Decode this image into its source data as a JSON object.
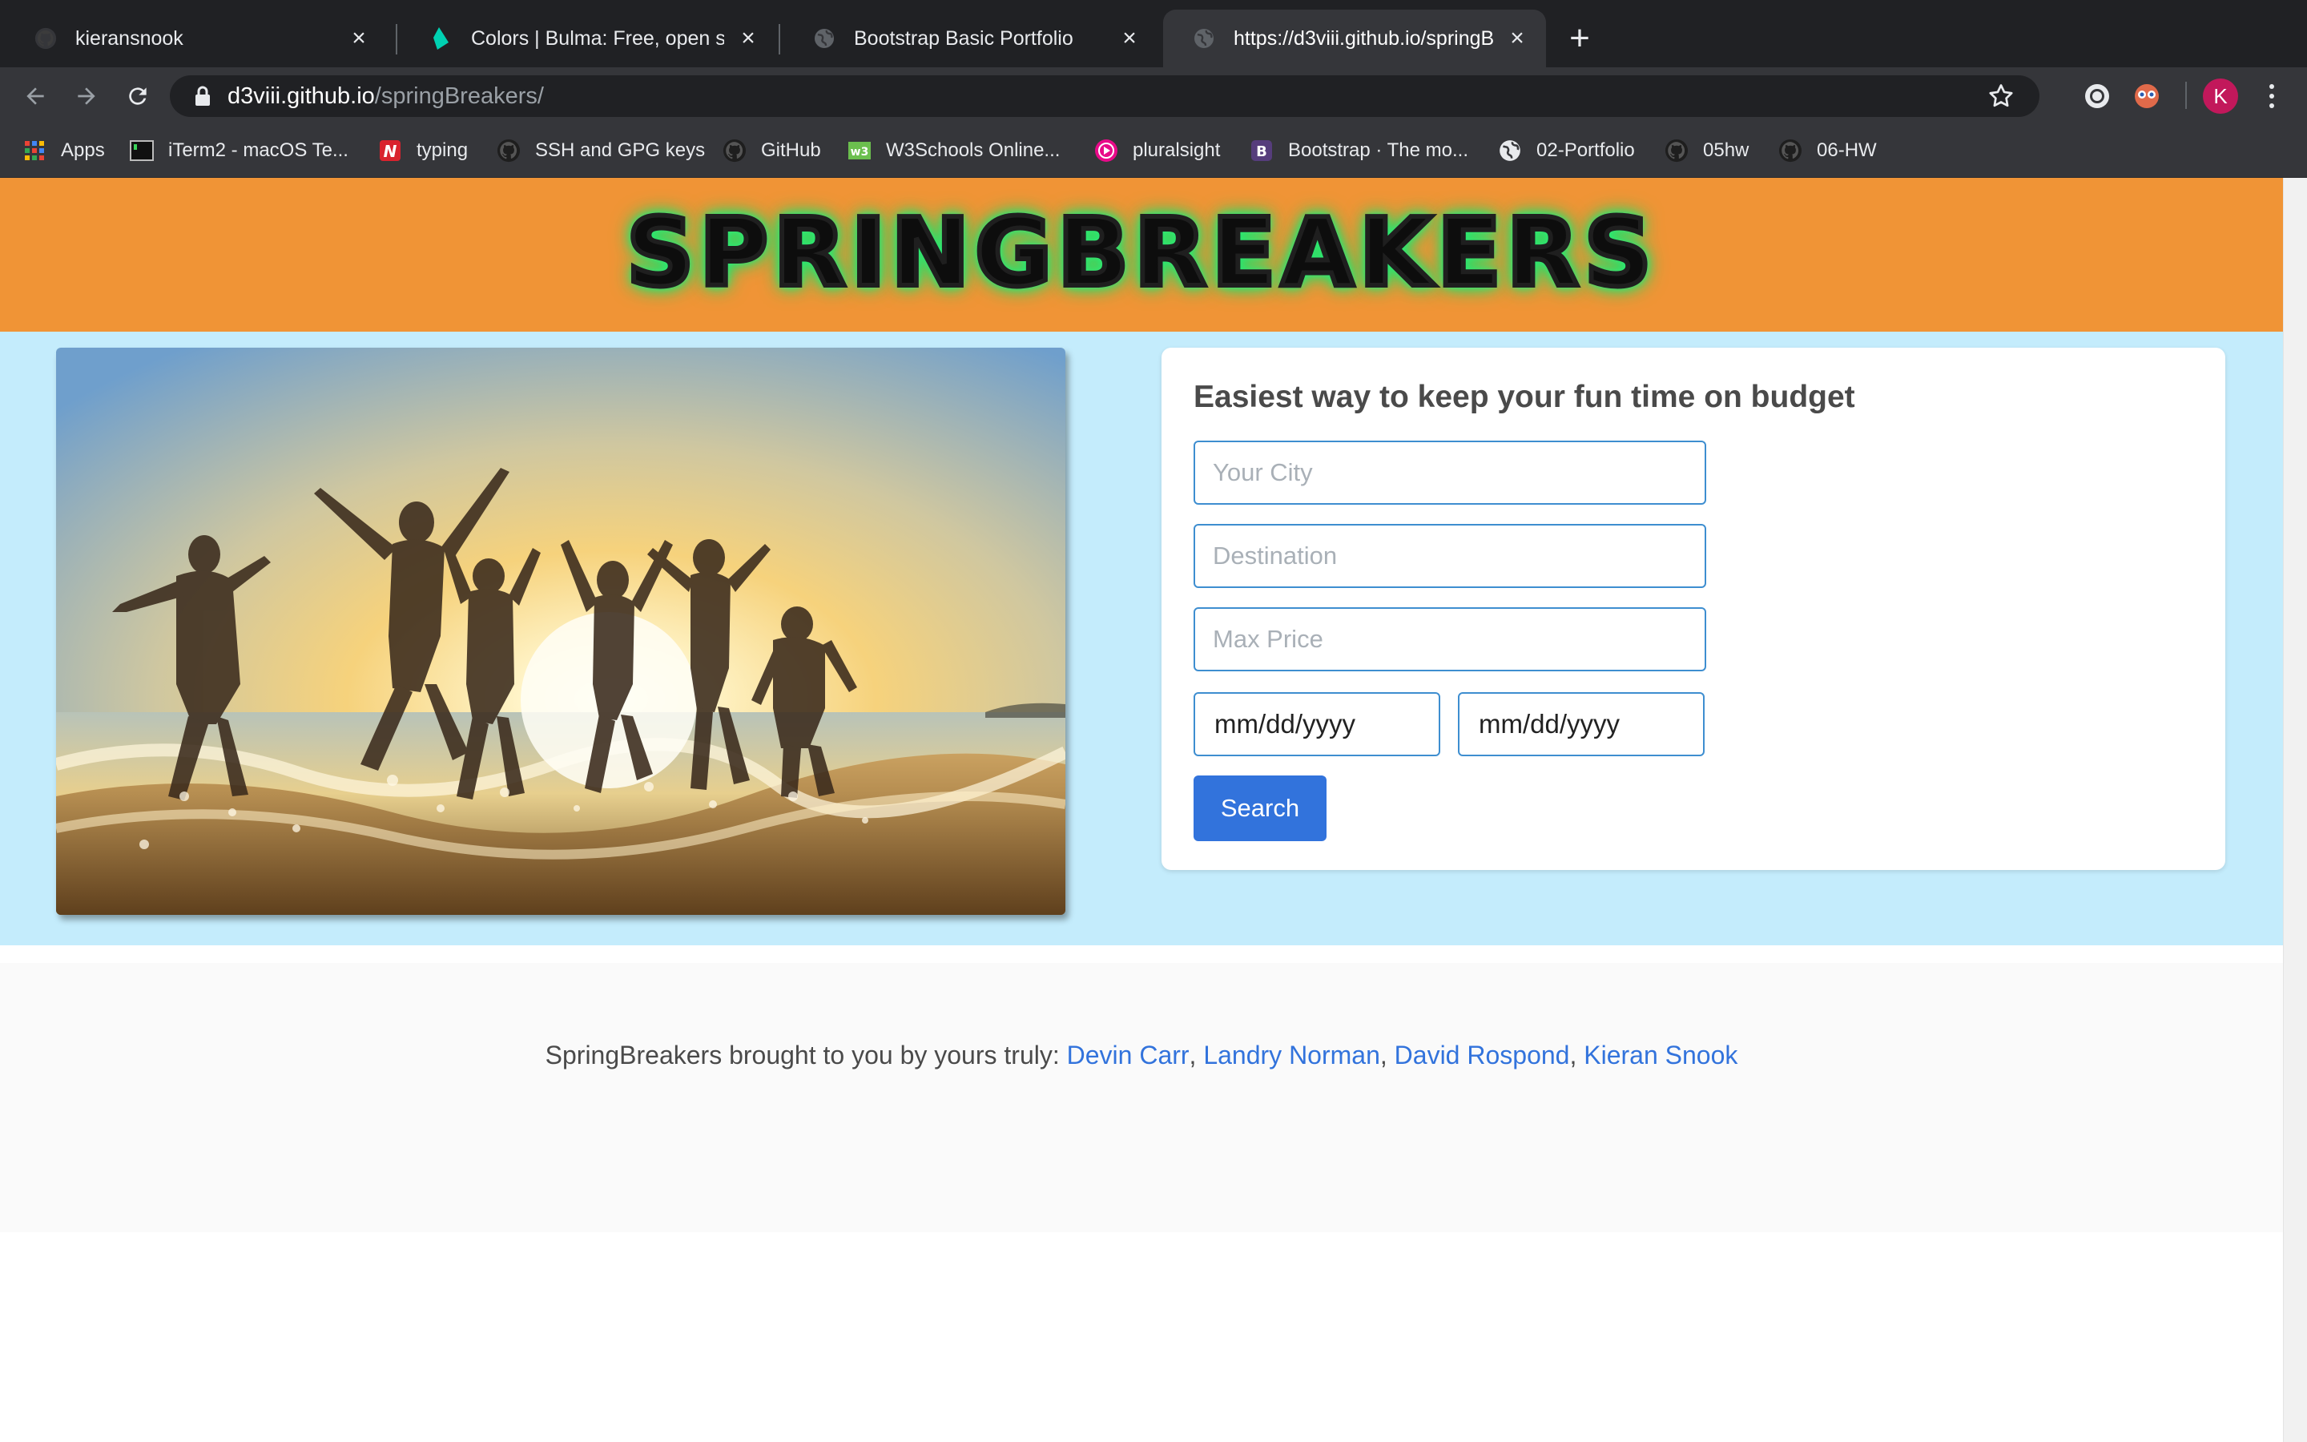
{
  "browser": {
    "tabs": [
      {
        "title": "kieransnook",
        "favicon": "github-icon",
        "active": false
      },
      {
        "title": "Colors | Bulma: Free, open source",
        "favicon": "bulma-icon",
        "active": false
      },
      {
        "title": "Bootstrap Basic Portfolio",
        "favicon": "globe-icon",
        "active": false
      },
      {
        "title": "https://d3viii.github.io/springBreakers/",
        "favicon": "globe-icon",
        "active": true
      }
    ],
    "new_tab": "+",
    "address": {
      "host": "d3viii.github.io",
      "path": "/springBreakers/"
    },
    "profile_initial": "K",
    "bookmarks": [
      {
        "label": "Apps",
        "icon": "apps-grid-icon"
      },
      {
        "label": "iTerm2 - macOS Te...",
        "icon": "terminal-icon"
      },
      {
        "label": "typing",
        "icon": "n-logo-icon"
      },
      {
        "label": "SSH and GPG keys",
        "icon": "github-icon"
      },
      {
        "label": "GitHub",
        "icon": "github-icon"
      },
      {
        "label": "W3Schools Online...",
        "icon": "w3schools-icon"
      },
      {
        "label": "pluralsight",
        "icon": "pluralsight-icon"
      },
      {
        "label": "Bootstrap · The mo...",
        "icon": "bootstrap-icon"
      },
      {
        "label": "02-Portfolio",
        "icon": "globe-icon"
      },
      {
        "label": "05hw",
        "icon": "github-icon"
      },
      {
        "label": "06-HW",
        "icon": "github-icon"
      }
    ]
  },
  "colors": {
    "header_bg": "#f09436",
    "content_bg": "#c4ecfc",
    "accent": "#3273dc",
    "logo_glow": "#2cf07a"
  },
  "header": {
    "logo_text": "SPRINGBREAKERS"
  },
  "hero_image": {
    "icon": "beach-photo"
  },
  "search_card": {
    "title": "Easiest way to keep your fun time on budget",
    "city_placeholder": "Your City",
    "destination_placeholder": "Destination",
    "max_price_placeholder": "Max Price",
    "start_date": "mm/dd/yyyy",
    "end_date": "mm/dd/yyyy",
    "search_label": "Search"
  },
  "footer": {
    "prefix": "SpringBreakers brought to you by yours truly: ",
    "authors": [
      "Devin Carr",
      "Landry Norman",
      "David Rospond",
      "Kieran Snook"
    ],
    "separator": ", "
  }
}
